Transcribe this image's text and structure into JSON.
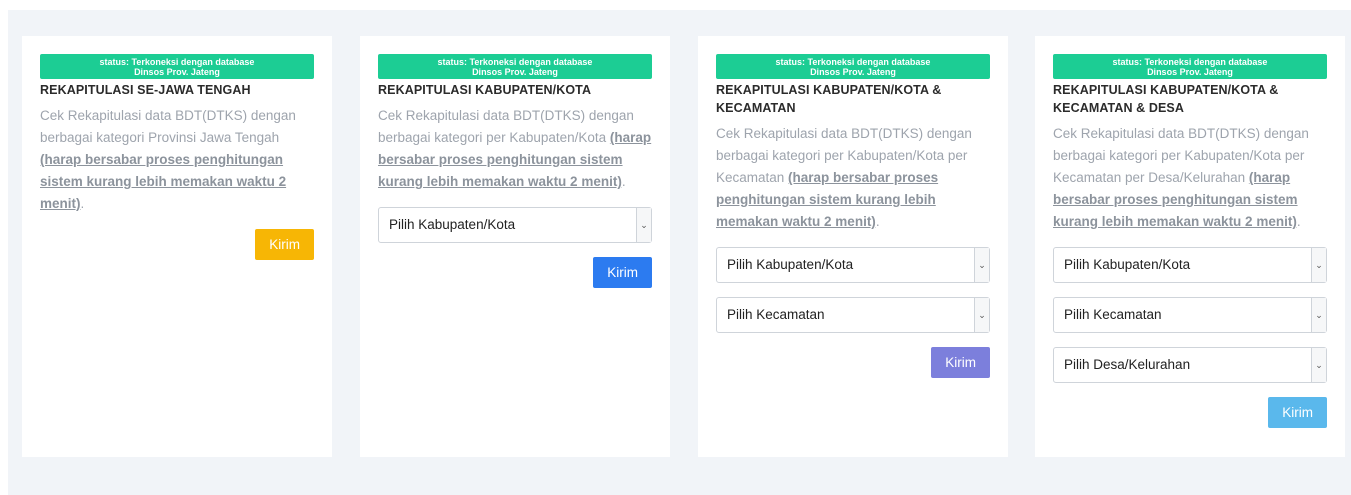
{
  "cards": [
    {
      "status_line1": "status: Terkoneksi dengan database",
      "status_line2": "Dinsos Prov. Jateng",
      "title": "REKAPITULASI SE-JAWA TENGAH",
      "desc": "Cek Rekapitulasi data BDT(DTKS) dengan berbagai kategori Provinsi Jawa Tengah ",
      "warn": "(harap bersabar proses penghitungan sistem kurang lebih memakan waktu 2 menit)",
      "button_label": "Kirim",
      "button_color": "#f7b605"
    },
    {
      "status_line1": "status: Terkoneksi dengan database",
      "status_line2": "Dinsos Prov. Jateng",
      "title": "REKAPITULASI KABUPATEN/KOTA",
      "desc": "Cek Rekapitulasi data BDT(DTKS) dengan berbagai kategori per Kabupaten/Kota ",
      "warn": "(harap bersabar proses penghitungan sistem kurang lebih memakan waktu 2 menit)",
      "select_kabupaten": "Pilih Kabupaten/Kota",
      "button_label": "Kirim",
      "button_color": "#2c7bf0"
    },
    {
      "status_line1": "status: Terkoneksi dengan database",
      "status_line2": "Dinsos Prov. Jateng",
      "title": "REKAPITULASI KABUPATEN/KOTA & KECAMATAN",
      "desc": "Cek Rekapitulasi data BDT(DTKS) dengan berbagai kategori per Kabupaten/Kota per Kecamatan ",
      "warn": "(harap bersabar proses penghitungan sistem kurang lebih memakan waktu 2 menit)",
      "select_kabupaten": "Pilih Kabupaten/Kota",
      "select_kecamatan": "Pilih Kecamatan",
      "button_label": "Kirim",
      "button_color": "#7c7fdc"
    },
    {
      "status_line1": "status: Terkoneksi dengan database",
      "status_line2": "Dinsos Prov. Jateng",
      "title": "REKAPITULASI KABUPATEN/KOTA & KECAMATAN & DESA",
      "desc": "Cek Rekapitulasi data BDT(DTKS) dengan berbagai kategori per Kabupaten/Kota per Kecamatan per Desa/Kelurahan ",
      "warn": "(harap bersabar proses penghitungan sistem kurang lebih memakan waktu 2 menit)",
      "select_kabupaten": "Pilih Kabupaten/Kota",
      "select_kecamatan": "Pilih Kecamatan",
      "select_desa": "Pilih Desa/Kelurahan",
      "button_label": "Kirim",
      "button_color": "#5ab8ec"
    }
  ],
  "icons": {
    "select_arrow": "chevron-down-icon"
  }
}
